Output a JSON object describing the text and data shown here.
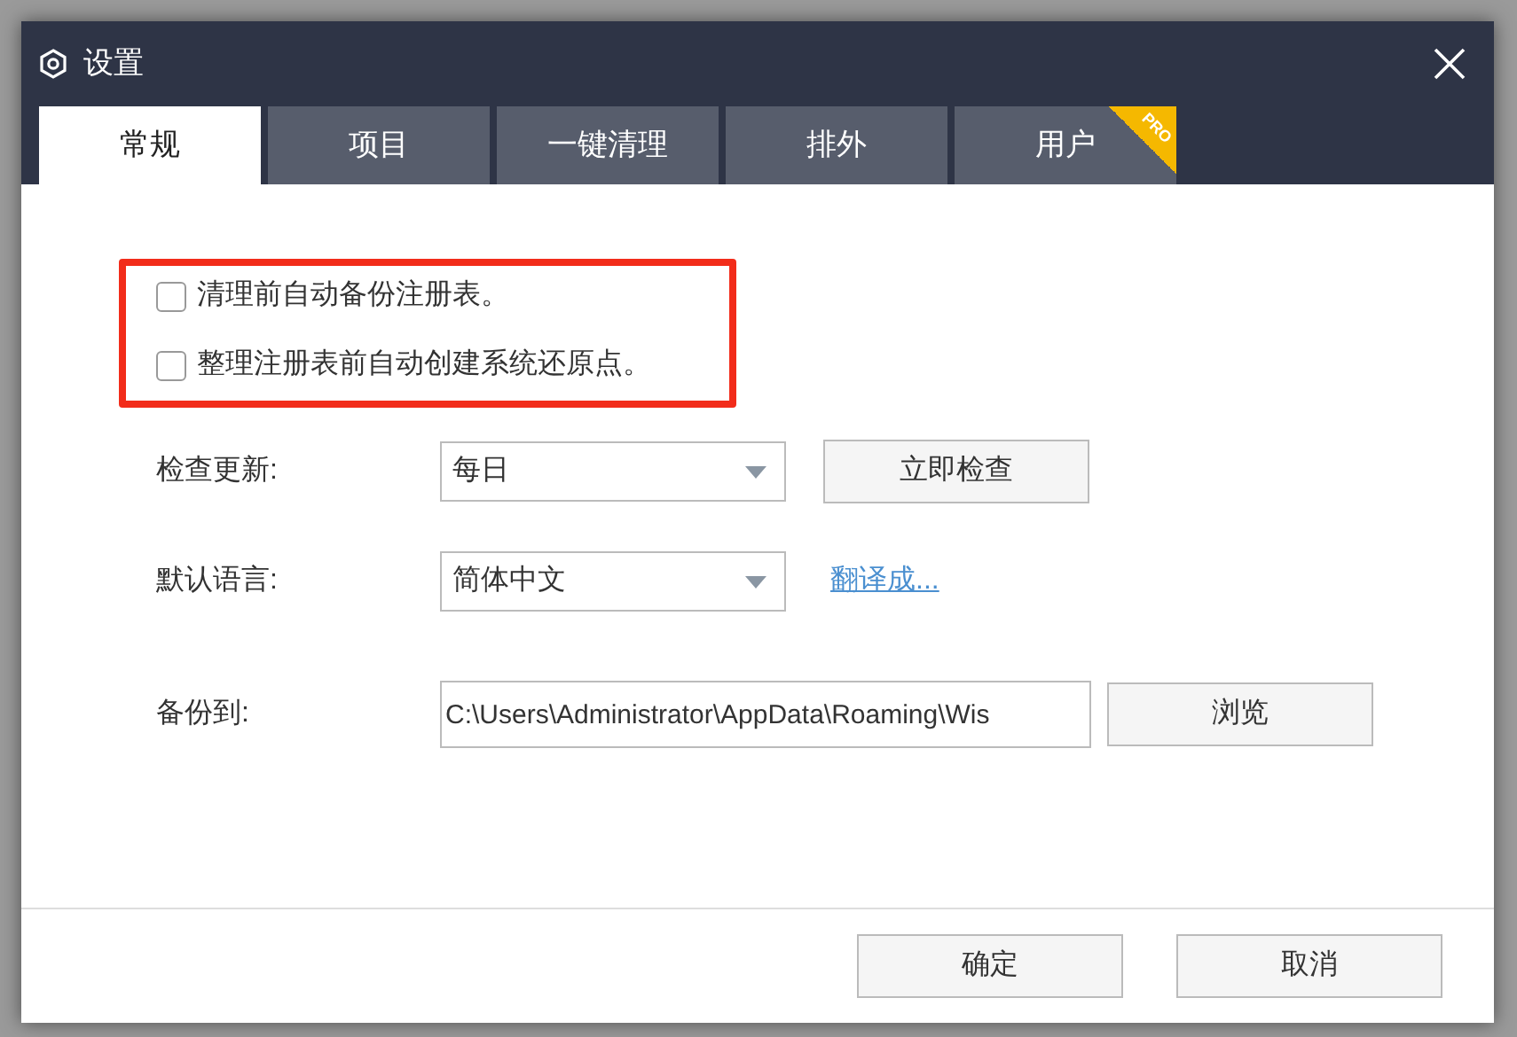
{
  "window": {
    "title": "设置"
  },
  "tabs": [
    {
      "label": "常规",
      "selected": true
    },
    {
      "label": "项目",
      "selected": false
    },
    {
      "label": "一键清理",
      "selected": false
    },
    {
      "label": "排外",
      "selected": false
    },
    {
      "label": "用户",
      "selected": false,
      "badge": "PRO"
    }
  ],
  "options": [
    {
      "label": "清理前自动备份注册表。",
      "checked": false
    },
    {
      "label": "整理注册表前自动创建系统还原点。",
      "checked": false
    }
  ],
  "check_update": {
    "label": "检查更新:",
    "value": "每日",
    "button": "立即检查"
  },
  "language": {
    "label": "默认语言:",
    "value": "简体中文",
    "link": "翻译成..."
  },
  "backup": {
    "label": "备份到:",
    "value": "C:\\Users\\Administrator\\AppData\\Roaming\\Wis",
    "button": "浏览"
  },
  "buttons": [
    "确定",
    "取消"
  ]
}
